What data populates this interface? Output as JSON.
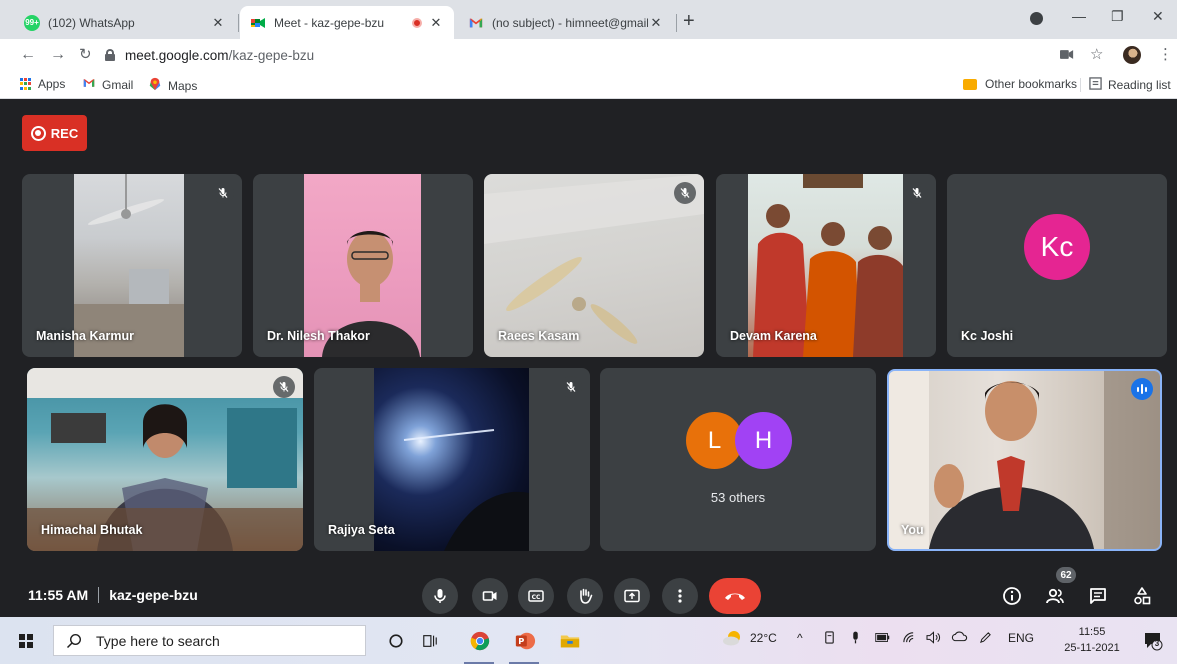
{
  "browser": {
    "tabs": [
      {
        "title": "(102) WhatsApp",
        "favicon": "whatsapp-icon",
        "badge": "99+",
        "active": false
      },
      {
        "title": "Meet - kaz-gepe-bzu",
        "favicon": "meet-icon",
        "active": true,
        "recording": true
      },
      {
        "title": "(no subject) - himneet@gmail.co",
        "favicon": "gmail-icon",
        "active": false
      }
    ],
    "url_host": "meet.google.com",
    "url_path": "/kaz-gepe-bzu",
    "bookmarks": [
      {
        "label": "Apps",
        "icon": "apps-grid-icon"
      },
      {
        "label": "Gmail",
        "icon": "gmail-icon"
      },
      {
        "label": "Maps",
        "icon": "maps-icon"
      }
    ],
    "other_bookmarks": "Other bookmarks",
    "reading_list": "Reading list"
  },
  "meet": {
    "rec_label": "REC",
    "tiles_row1": [
      {
        "name": "Manisha Karmur",
        "muted": true
      },
      {
        "name": "Dr. Nilesh Thakor",
        "muted": false
      },
      {
        "name": "Raees Kasam",
        "muted": true
      },
      {
        "name": "Devam Karena",
        "muted": true
      },
      {
        "name": "Kc Joshi",
        "muted": false,
        "initials": "Kc",
        "avatar_color": "#e52592"
      }
    ],
    "tiles_row2": [
      {
        "name": "Himachal Bhutak",
        "muted": true
      },
      {
        "name": "Rajiya Seta",
        "muted": true
      },
      {
        "name": "53 others",
        "muted": false,
        "avatars": [
          {
            "letter": "L",
            "color": "#e8710a"
          },
          {
            "letter": "H",
            "color": "#a142f4"
          }
        ]
      },
      {
        "name": "You",
        "muted": false,
        "speaking": true
      }
    ],
    "time": "11:55 AM",
    "meeting_code": "kaz-gepe-bzu",
    "people_count": "62",
    "end_call_color": "#ea4335",
    "accent_color": "#8ab4f8"
  },
  "taskbar": {
    "search_placeholder": "Type here to search",
    "weather": "22°C",
    "language": "ENG",
    "time": "11:55",
    "date": "25-11-2021",
    "notification_count": "3"
  }
}
